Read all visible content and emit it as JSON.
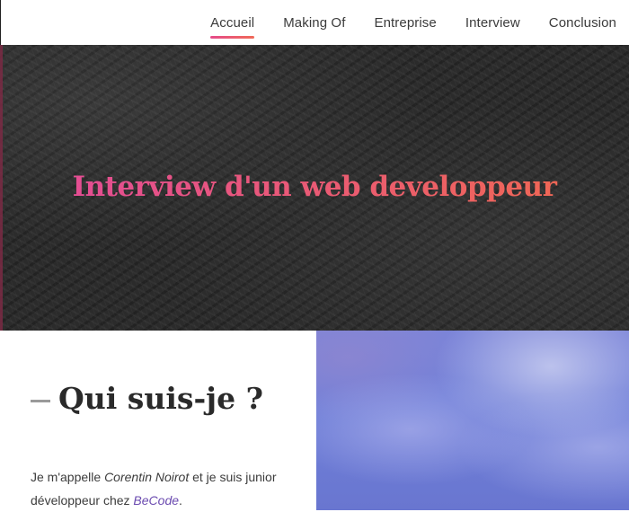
{
  "nav": {
    "items": [
      {
        "label": "Accueil",
        "active": true
      },
      {
        "label": "Making Of",
        "active": false
      },
      {
        "label": "Entreprise",
        "active": false
      },
      {
        "label": "Interview",
        "active": false
      },
      {
        "label": "Conclusion",
        "active": false
      }
    ]
  },
  "hero": {
    "title": "Interview d'un web developpeur"
  },
  "about": {
    "title": "Qui suis-je ?",
    "intro_1": "Je m'appelle ",
    "name": "Corentin Noirot",
    "intro_2": " et je suis junior développeur chez ",
    "company": "BeCode",
    "intro_3": "."
  },
  "colors": {
    "accent_start": "#e24a9c",
    "accent_end": "#f16a4d",
    "link": "#6b4bb0"
  }
}
